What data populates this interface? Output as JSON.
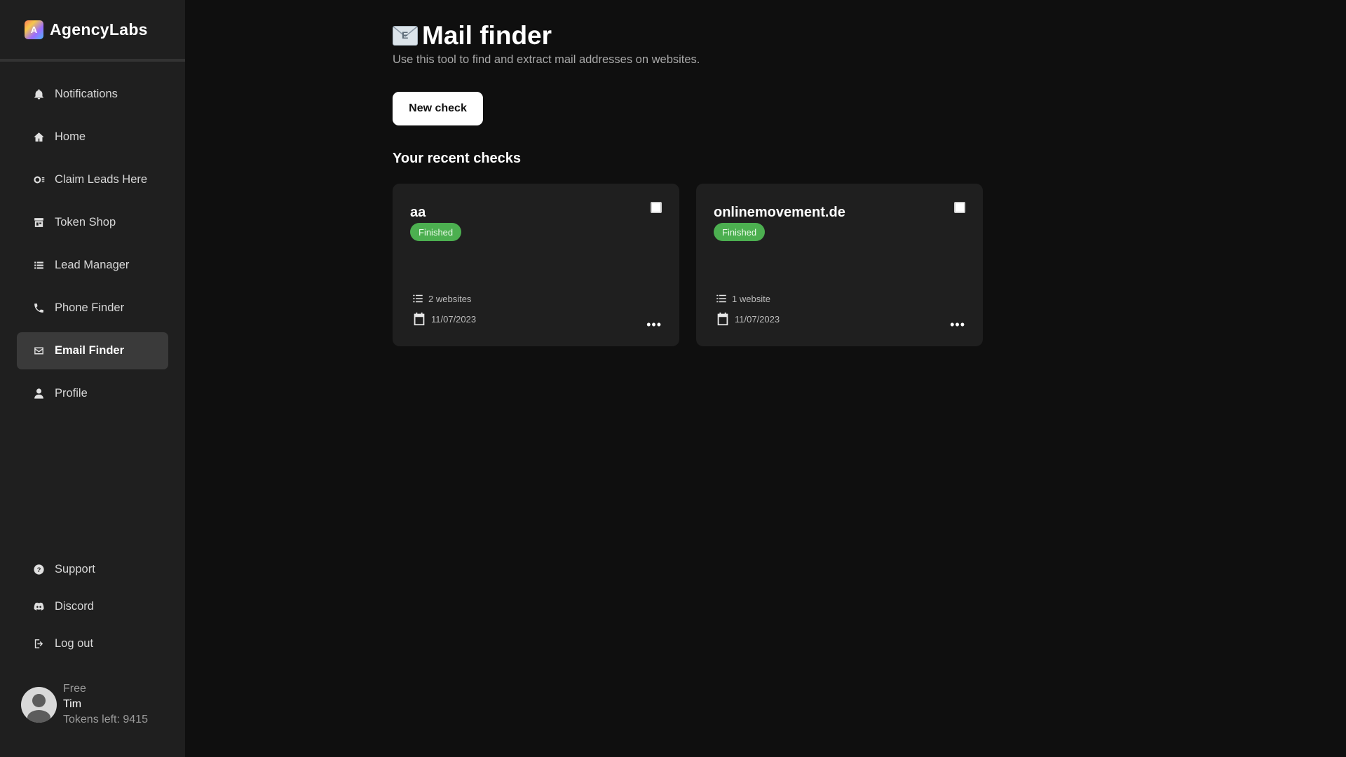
{
  "brand": {
    "name": "AgencyLabs",
    "logo_letter": "A"
  },
  "sidebar": {
    "items": [
      {
        "label": "Notifications",
        "icon": "bell-icon"
      },
      {
        "label": "Home",
        "icon": "home-icon"
      },
      {
        "label": "Claim Leads Here",
        "icon": "claim-icon"
      },
      {
        "label": "Token Shop",
        "icon": "store-icon"
      },
      {
        "label": "Lead Manager",
        "icon": "list-icon"
      },
      {
        "label": "Phone Finder",
        "icon": "phone-icon"
      },
      {
        "label": "Email Finder",
        "icon": "mail-icon"
      },
      {
        "label": "Profile",
        "icon": "user-icon"
      }
    ],
    "bottom_items": [
      {
        "label": "Support",
        "icon": "help-icon"
      },
      {
        "label": "Discord",
        "icon": "discord-icon"
      },
      {
        "label": "Log out",
        "icon": "logout-icon"
      }
    ]
  },
  "user": {
    "plan": "Free",
    "name": "Tim",
    "tokens": "Tokens left: 9415"
  },
  "main": {
    "title": "Mail finder",
    "subtitle": "Use this tool to find and extract mail addresses on websites.",
    "new_check_label": "New check",
    "recent_title": "Your recent checks",
    "cards": [
      {
        "title": "aa",
        "status": "Finished",
        "sites": "2 websites",
        "date": "11/07/2023"
      },
      {
        "title": "onlinemovement.de",
        "status": "Finished",
        "sites": "1 website",
        "date": "11/07/2023"
      }
    ]
  },
  "colors": {
    "accent_green": "#4caf50",
    "sidebar_bg": "#1f1f1f",
    "page_bg": "#0f0f0f"
  }
}
